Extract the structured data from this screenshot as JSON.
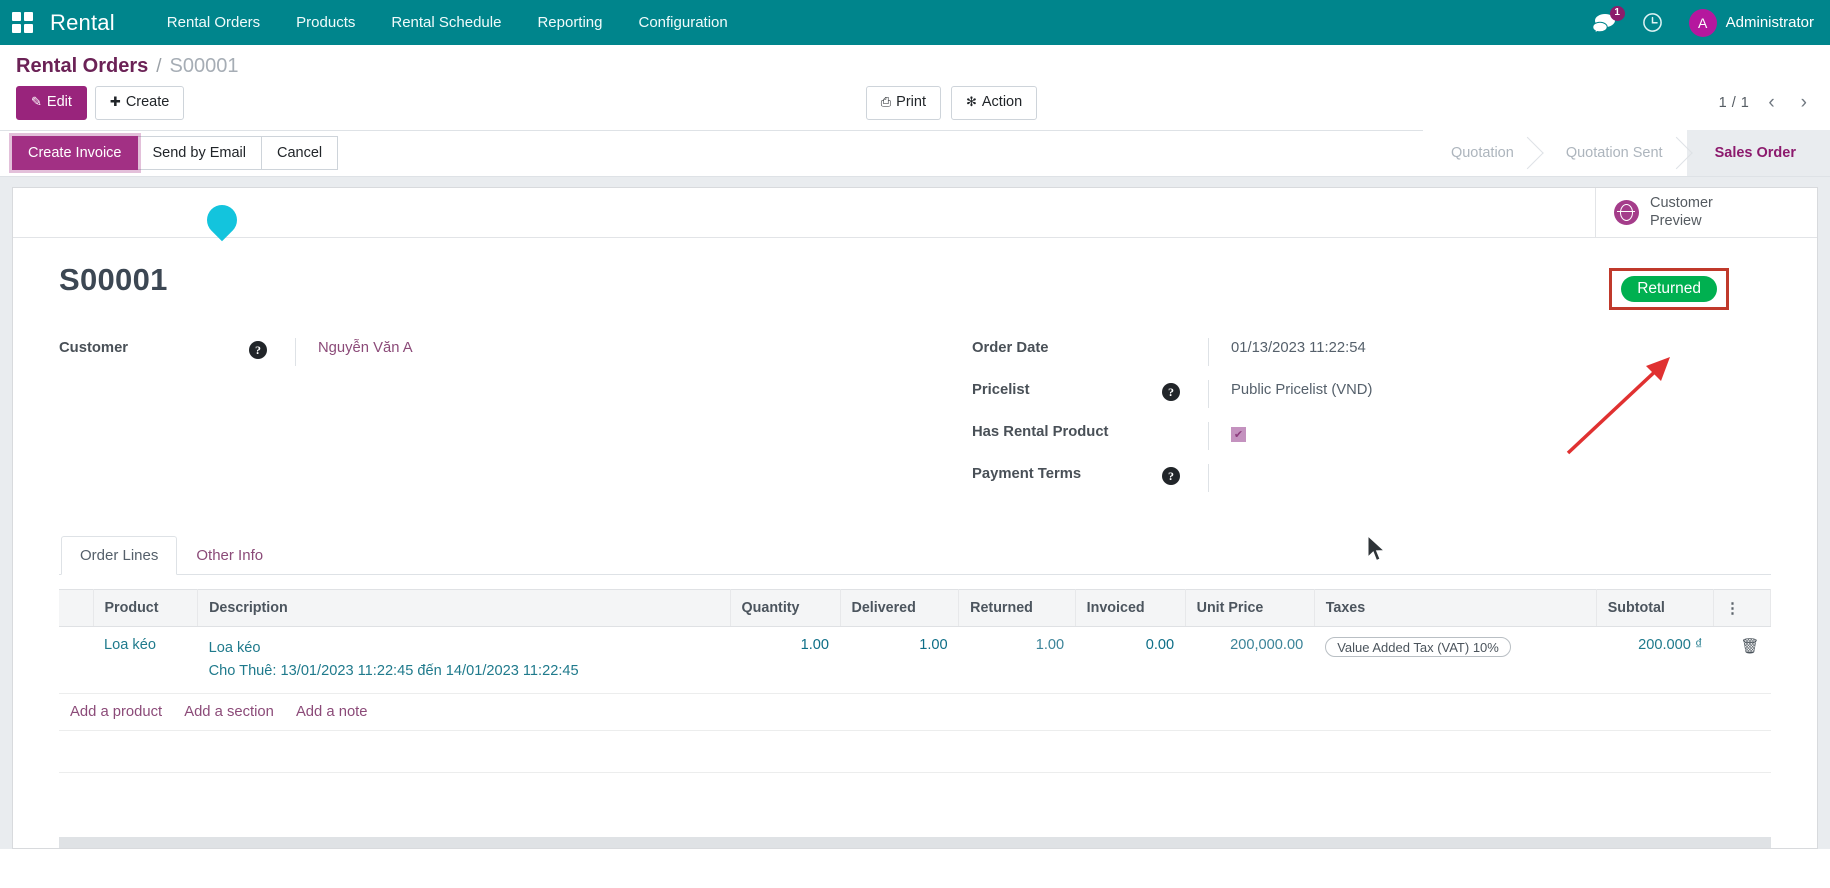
{
  "navbar": {
    "apps_icon": "apps-grid-icon",
    "brand": "Rental",
    "menu": [
      {
        "label": "Rental Orders"
      },
      {
        "label": "Products"
      },
      {
        "label": "Rental Schedule"
      },
      {
        "label": "Reporting"
      },
      {
        "label": "Configuration"
      }
    ],
    "messages_icon": "chat-bubbles-icon",
    "messages_count": "1",
    "activities_icon": "clock-icon",
    "avatar_initial": "A",
    "user_name": "Administrator",
    "bg_color": "#00858c"
  },
  "control_panel": {
    "breadcrumb_root": "Rental Orders",
    "breadcrumb_separator": "/",
    "breadcrumb_current": "S00001",
    "edit_label": "Edit",
    "create_label": "Create",
    "print_label": "Print",
    "action_label": "Action",
    "pager": "1 / 1",
    "prev_icon": "chevron-left-icon",
    "next_icon": "chevron-right-icon"
  },
  "statusbar": {
    "buttons": [
      {
        "label": "Create Invoice",
        "state": "focused-primary"
      },
      {
        "label": "Send by Email",
        "state": "default"
      },
      {
        "label": "Cancel",
        "state": "default"
      }
    ],
    "stages": [
      {
        "label": "Quotation",
        "active": false
      },
      {
        "label": "Quotation Sent",
        "active": false
      },
      {
        "label": "Sales Order",
        "active": true
      }
    ]
  },
  "sheet": {
    "customer_preview_label": "Customer\nPreview",
    "customer_preview_icon": "globe-icon",
    "title": "S00001",
    "ribbon": "Returned",
    "ribbon_color": "#00b050",
    "annotation_box_color": "#c0392b",
    "left_fields": [
      {
        "label": "Customer",
        "help": "?",
        "value": "Nguyễn Văn A",
        "type": "link"
      }
    ],
    "right_fields": [
      {
        "label": "Order Date",
        "help": "",
        "value": "01/13/2023 11:22:54",
        "type": "text"
      },
      {
        "label": "Pricelist",
        "help": "?",
        "value": "Public Pricelist (VND)",
        "type": "text"
      },
      {
        "label": "Has Rental Product",
        "help": "",
        "value": "✔",
        "type": "checkbox"
      },
      {
        "label": "Payment Terms",
        "help": "?",
        "value": "",
        "type": "text"
      }
    ],
    "tabs": [
      {
        "label": "Order Lines",
        "active": true
      },
      {
        "label": "Other Info",
        "active": false
      }
    ],
    "table": {
      "columns": [
        "Product",
        "Description",
        "Quantity",
        "Delivered",
        "Returned",
        "Invoiced",
        "Unit Price",
        "Taxes",
        "Subtotal"
      ],
      "options_icon": "vertical-dots-icon",
      "rows": [
        {
          "product": "Loa kéo",
          "description": "Loa kéo",
          "description_sub": "Cho Thuê: 13/01/2023 11:22:45 đến 14/01/2023 11:22:45",
          "quantity": "1.00",
          "delivered": "1.00",
          "returned": "1.00",
          "invoiced": "0.00",
          "unit_price": "200,000.00",
          "taxes": "Value Added Tax (VAT) 10%",
          "subtotal": "200.000 ₫",
          "delete_icon": "trash-icon"
        }
      ],
      "add_links": [
        {
          "label": "Add a product"
        },
        {
          "label": "Add a section"
        },
        {
          "label": "Add a note"
        }
      ]
    }
  },
  "annotations": {
    "drop_marker": "teal-drop-marker",
    "arrow": "red-arrow-pointing-to-returned-badge",
    "arrow_color": "#e03131",
    "mouse_cursor": "mouse-pointer"
  }
}
